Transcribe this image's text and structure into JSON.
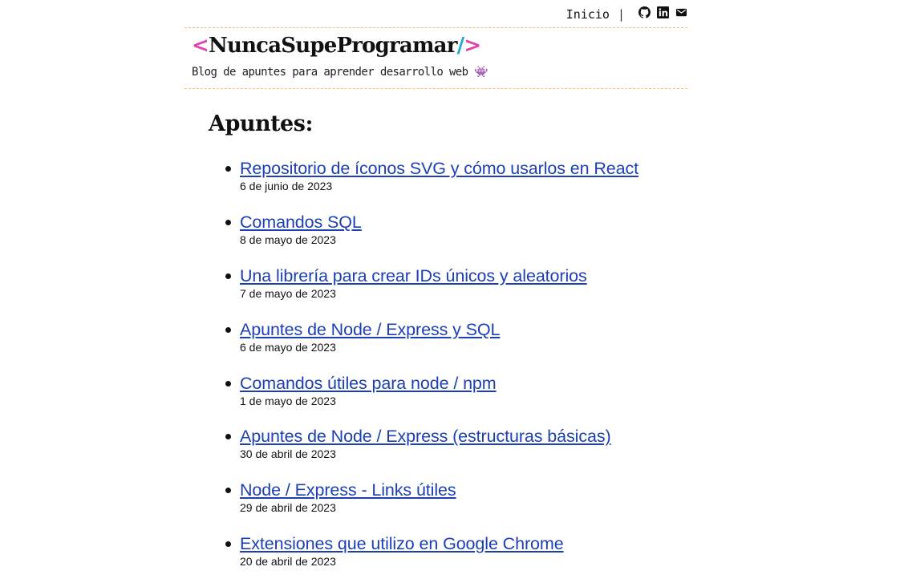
{
  "nav": {
    "home_label": "Inicio",
    "separator": "|",
    "icons": [
      "github-icon",
      "linkedin-icon",
      "mail-icon"
    ]
  },
  "header": {
    "logo_open": "<",
    "logo_name": "NuncaSupeProgramar",
    "logo_slash": "/",
    "logo_close": ">",
    "tagline": "Blog de apuntes para aprender desarrollo web 👾"
  },
  "main": {
    "section_title": "Apuntes:",
    "posts": [
      {
        "title": "Repositorio de íconos SVG y cómo usarlos en React",
        "date": "6 de junio de 2023"
      },
      {
        "title": "Comandos SQL",
        "date": "8 de mayo de 2023"
      },
      {
        "title": "Una librería para crear IDs únicos y aleatorios",
        "date": "7 de mayo de 2023"
      },
      {
        "title": "Apuntes de Node / Express y SQL",
        "date": "6 de mayo de 2023"
      },
      {
        "title": "Comandos útiles para node / npm",
        "date": "1 de mayo de 2023"
      },
      {
        "title": "Apuntes de Node / Express (estructuras básicas)",
        "date": "30 de abril de 2023"
      },
      {
        "title": "Node / Express - Links útiles",
        "date": "29 de abril de 2023"
      },
      {
        "title": "Extensiones que utilizo en Google Chrome",
        "date": "20 de abril de 2023"
      }
    ]
  },
  "colors": {
    "accent_pink": "#e040b0",
    "accent_blue": "#20a6d8",
    "link": "#1d3fb5",
    "dashed_border": "#f2c070"
  }
}
